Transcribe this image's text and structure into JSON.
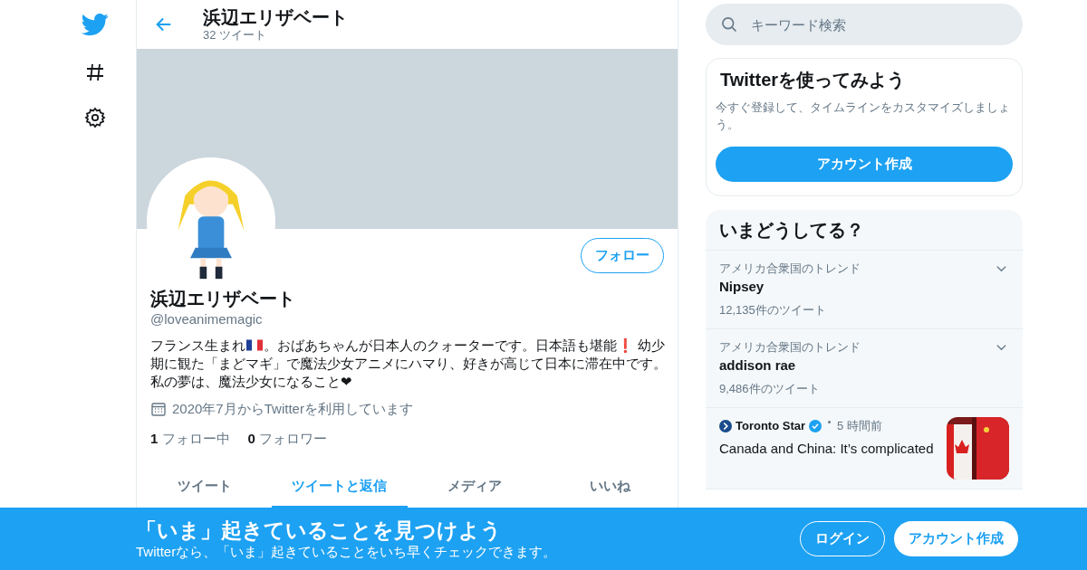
{
  "header": {
    "title": "浜辺エリザベート",
    "tweet_count": "32 ツイート"
  },
  "search": {
    "placeholder": "キーワード検索"
  },
  "profile": {
    "name": "浜辺エリザベート",
    "handle": "@loveanimemagic",
    "follow_button": "フォロー",
    "bio": [
      {
        "kind": "text",
        "text": "フランス生まれ"
      },
      {
        "kind": "flag"
      },
      {
        "kind": "text",
        "text": "。おばあちゃんが日本人のクォーターです。日本語も堪能❗ 幼少期に観た「まどマギ」で魔法少女アニメにハマり、好きが高じて日本に滞在中です。私の夢は、魔法少女になること❤"
      }
    ],
    "joined": "2020年7月からTwitterを利用しています",
    "stats": [
      {
        "count": "1",
        "label": "フォロー中"
      },
      {
        "count": "0",
        "label": "フォロワー"
      }
    ]
  },
  "tabs": [
    {
      "label": "ツイート",
      "selected": false
    },
    {
      "label": "ツイートと返信",
      "selected": true
    },
    {
      "label": "メディア",
      "selected": false
    },
    {
      "label": "いいね",
      "selected": false
    }
  ],
  "signup_card": {
    "title": "Twitterを使ってみよう",
    "text": "今すぐ登録して、タイムラインをカスタマイズしましょう。",
    "button": "アカウント作成"
  },
  "trends": {
    "title": "いまどうしてる？",
    "items": [
      {
        "context": "アメリカ合衆国のトレンド",
        "name": "Nipsey",
        "count": "12,135件のツイート"
      },
      {
        "context": "アメリカ合衆国のトレンド",
        "name": "addison rae",
        "count": "9,486件のツイート"
      }
    ],
    "news": [
      {
        "source": "Toronto Star",
        "time": "5 時間前",
        "headline": "Canada and China: It’s complicated"
      }
    ]
  },
  "bottom_bar": {
    "title": "「いま」起きていることを見つけよう",
    "text": "Twitterなら、「いま」起きていることをいち早くチェックできます。",
    "login": "ログイン",
    "signup": "アカウント作成"
  }
}
